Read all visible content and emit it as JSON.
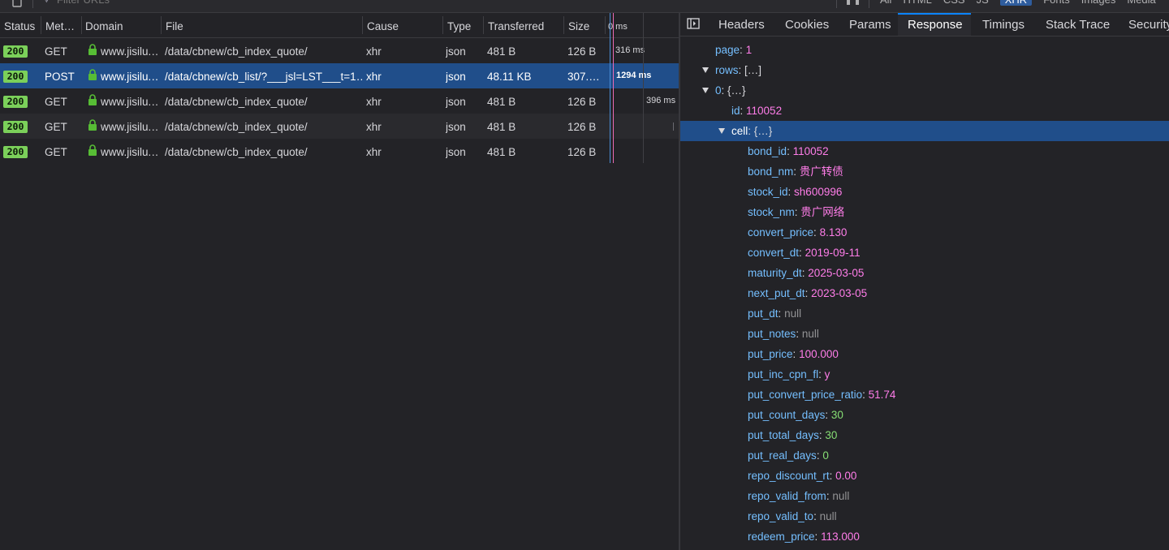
{
  "toolbar": {
    "filter_placeholder": "Filter URLs",
    "type_filters": [
      {
        "label": "All",
        "active": false
      },
      {
        "label": "HTML",
        "active": false
      },
      {
        "label": "CSS",
        "active": false
      },
      {
        "label": "JS",
        "active": false
      },
      {
        "label": "XHR",
        "active": true
      },
      {
        "label": "Fonts",
        "active": false
      },
      {
        "label": "Images",
        "active": false
      },
      {
        "label": "Media",
        "active": false
      }
    ]
  },
  "request_table": {
    "columns": {
      "status": "Status",
      "method": "Met…",
      "domain": "Domain",
      "file": "File",
      "cause": "Cause",
      "type": "Type",
      "transferred": "Transferred",
      "size": "Size",
      "waterfall": "0 ms"
    },
    "rows": [
      {
        "status": "200",
        "method": "GET",
        "domain": "www.jisilu.…",
        "file": "/data/cbnew/cb_index_quote/",
        "cause": "xhr",
        "type": "json",
        "transferred": "481 B",
        "size": "126 B",
        "timing": "316 ms"
      },
      {
        "status": "200",
        "method": "POST",
        "domain": "www.jisilu.…",
        "file": "/data/cbnew/cb_list/?___jsl=LST___t=1…",
        "cause": "xhr",
        "type": "json",
        "transferred": "48.11 KB",
        "size": "307.…",
        "timing": "1294 ms"
      },
      {
        "status": "200",
        "method": "GET",
        "domain": "www.jisilu.…",
        "file": "/data/cbnew/cb_index_quote/",
        "cause": "xhr",
        "type": "json",
        "transferred": "481 B",
        "size": "126 B",
        "timing": "396 ms"
      },
      {
        "status": "200",
        "method": "GET",
        "domain": "www.jisilu.…",
        "file": "/data/cbnew/cb_index_quote/",
        "cause": "xhr",
        "type": "json",
        "transferred": "481 B",
        "size": "126 B",
        "timing": ""
      },
      {
        "status": "200",
        "method": "GET",
        "domain": "www.jisilu.…",
        "file": "/data/cbnew/cb_index_quote/",
        "cause": "xhr",
        "type": "json",
        "transferred": "481 B",
        "size": "126 B",
        "timing": ""
      }
    ],
    "selected_row": 1
  },
  "details": {
    "tabs": [
      "Headers",
      "Cookies",
      "Params",
      "Response",
      "Timings",
      "Stack Trace",
      "Security"
    ],
    "active_tab": "Response",
    "tree": [
      {
        "key": "page",
        "value": "1",
        "kind": "num",
        "depth": 0
      },
      {
        "key": "rows",
        "value": "[…]",
        "kind": "obj",
        "depth": 0,
        "expanded": true
      },
      {
        "key": "0",
        "value": "{…}",
        "kind": "obj",
        "depth": 1,
        "expanded": true
      },
      {
        "key": "id",
        "value": "110052",
        "kind": "num",
        "depth": 2
      },
      {
        "key": "cell",
        "value": "{…}",
        "kind": "obj",
        "depth": 2,
        "expanded": true,
        "selected": true
      },
      {
        "key": "bond_id",
        "value": "110052",
        "kind": "str",
        "depth": 3
      },
      {
        "key": "bond_nm",
        "value": "贵广转债",
        "kind": "str",
        "depth": 3
      },
      {
        "key": "stock_id",
        "value": "sh600996",
        "kind": "str",
        "depth": 3
      },
      {
        "key": "stock_nm",
        "value": "贵广网络",
        "kind": "str",
        "depth": 3
      },
      {
        "key": "convert_price",
        "value": "8.130",
        "kind": "str",
        "depth": 3
      },
      {
        "key": "convert_dt",
        "value": "2019-09-11",
        "kind": "str",
        "depth": 3
      },
      {
        "key": "maturity_dt",
        "value": "2025-03-05",
        "kind": "str",
        "depth": 3
      },
      {
        "key": "next_put_dt",
        "value": "2023-03-05",
        "kind": "str",
        "depth": 3
      },
      {
        "key": "put_dt",
        "value": "null",
        "kind": "null",
        "depth": 3
      },
      {
        "key": "put_notes",
        "value": "null",
        "kind": "null",
        "depth": 3
      },
      {
        "key": "put_price",
        "value": "100.000",
        "kind": "str",
        "depth": 3
      },
      {
        "key": "put_inc_cpn_fl",
        "value": "y",
        "kind": "str",
        "depth": 3
      },
      {
        "key": "put_convert_price_ratio",
        "value": "51.74",
        "kind": "str",
        "depth": 3
      },
      {
        "key": "put_count_days",
        "value": "30",
        "kind": "green",
        "depth": 3
      },
      {
        "key": "put_total_days",
        "value": "30",
        "kind": "green",
        "depth": 3
      },
      {
        "key": "put_real_days",
        "value": "0",
        "kind": "green",
        "depth": 3
      },
      {
        "key": "repo_discount_rt",
        "value": "0.00",
        "kind": "str",
        "depth": 3
      },
      {
        "key": "repo_valid_from",
        "value": "null",
        "kind": "null",
        "depth": 3
      },
      {
        "key": "repo_valid_to",
        "value": "null",
        "kind": "null",
        "depth": 3
      },
      {
        "key": "redeem_price",
        "value": "113.000",
        "kind": "str",
        "depth": 3
      }
    ]
  },
  "colors": {
    "background": "#232327",
    "selection": "#204e8a",
    "status_ok": "#7bd05a",
    "json_key": "#75bfff",
    "json_string": "#ff7de9",
    "json_number": "#86de74",
    "json_null": "#939395",
    "tab_accent": "#0a84ff"
  }
}
